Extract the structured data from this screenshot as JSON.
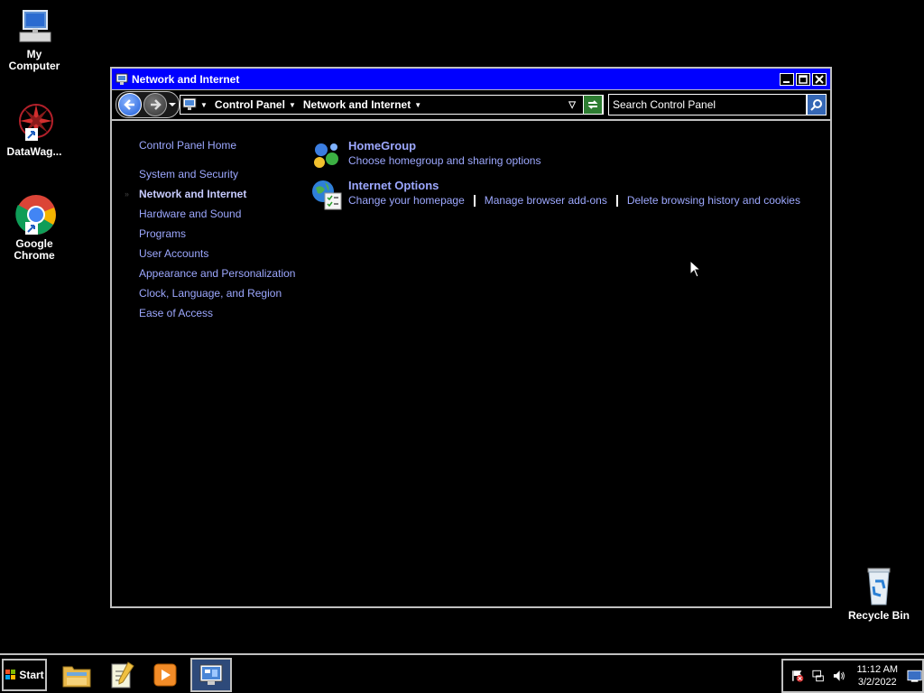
{
  "desktop": {
    "icons": [
      {
        "label": "My Computer"
      },
      {
        "label": "DataWag..."
      },
      {
        "label": "Google Chrome"
      },
      {
        "label": "Recycle Bin"
      }
    ]
  },
  "window": {
    "title": "Network and Internet",
    "address": {
      "crumbs": [
        "Control Panel",
        "Network and Internet"
      ]
    },
    "search": {
      "placeholder": "Search Control Panel"
    }
  },
  "leftnav": {
    "home": "Control Panel Home",
    "items": [
      "System and Security",
      "Network and Internet",
      "Hardware and Sound",
      "Programs",
      "User Accounts",
      "Appearance and Personalization",
      "Clock, Language, and Region",
      "Ease of Access"
    ],
    "active_index": 1
  },
  "main": {
    "categories": [
      {
        "title": "HomeGroup",
        "links": [
          "Choose homegroup and sharing options"
        ]
      },
      {
        "title": "Internet Options",
        "links": [
          "Change your homepage",
          "Manage browser add-ons",
          "Delete browsing history and cookies"
        ]
      }
    ]
  },
  "taskbar": {
    "start_label": "Start",
    "apps": [
      "file-explorer-icon",
      "notepad-icon",
      "media-player-icon",
      "control-panel-icon"
    ],
    "clock": {
      "time": "11:12 AM",
      "date": "3/2/2022"
    }
  },
  "colors": {
    "titlebar": "#0000ff",
    "link": "#9da8ff",
    "background": "#000000"
  }
}
